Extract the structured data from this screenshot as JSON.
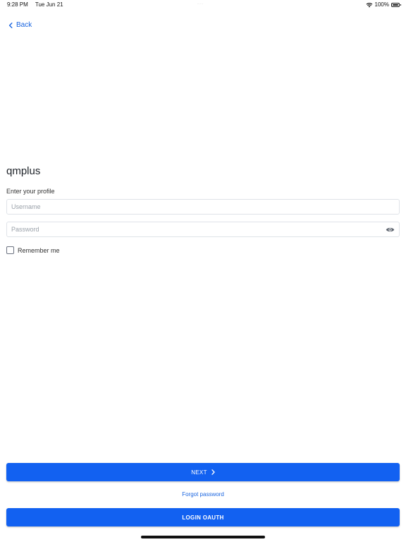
{
  "status_bar": {
    "time": "9:28 PM",
    "date": "Tue Jun 21",
    "battery_percent": "100%",
    "wifi_icon": "wifi-icon",
    "battery_icon": "battery-icon"
  },
  "nav": {
    "back_label": "Back",
    "back_icon": "chevron-left-icon"
  },
  "form": {
    "title": "qmplus",
    "subtitle": "Enter your profile",
    "username": {
      "placeholder": "Username",
      "value": ""
    },
    "password": {
      "placeholder": "Password",
      "value": "",
      "toggle_icon": "eye-icon"
    },
    "remember_label": "Remember me",
    "remember_checked": false
  },
  "actions": {
    "next_label": "NEXT",
    "next_icon": "chevron-right-icon",
    "forgot_label": "Forgot password",
    "oauth_label": "LOGIN OAUTH"
  },
  "colors": {
    "accent": "#1261f1",
    "link": "#1a65e0"
  }
}
